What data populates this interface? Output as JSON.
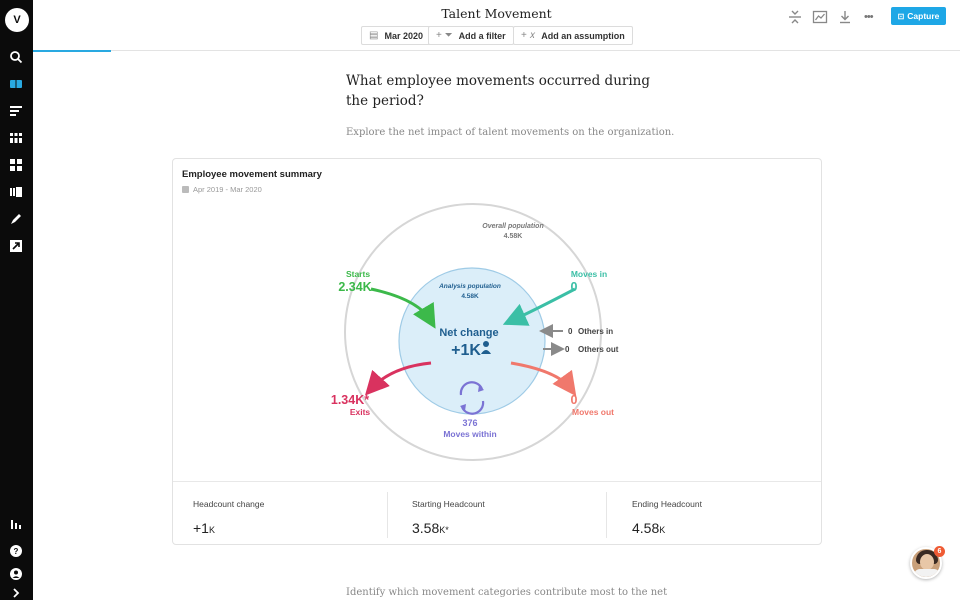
{
  "app": {
    "title": "Talent Movement",
    "logo_text": "V"
  },
  "toolbar": {
    "date_filter": "Mar 2020",
    "add_filter": "Add a filter",
    "add_assumption": "Add an assumption",
    "capture_label": "Capture",
    "more_label": "•••"
  },
  "sidebar": {
    "icons": [
      "search-icon",
      "book-icon",
      "list-icon",
      "grid-dots-icon",
      "dashboard-icon",
      "library-icon",
      "pen-icon",
      "export-icon",
      "bar-chart-icon",
      "help-icon",
      "user-icon",
      "expand-icon"
    ]
  },
  "content": {
    "question": "What employee movements occurred during the period?",
    "subtext": "Explore the net impact of talent movements on the organization.",
    "footer_text": "Identify which movement categories contribute most to the net"
  },
  "card": {
    "title": "Employee movement summary",
    "date_range": "Apr 2019 - Mar 2020"
  },
  "diagram": {
    "overall_label": "Overall population",
    "overall_value": "4.58K",
    "analysis_label": "Analysis population",
    "analysis_value": "4.58K",
    "net_label": "Net change",
    "net_value": "+1K",
    "starts_label": "Starts",
    "starts_value": "2.34K",
    "moves_in_label": "Moves in",
    "moves_in_value": "0",
    "exits_label": "Exits",
    "exits_value": "1.34K*",
    "moves_out_label": "Moves out",
    "moves_out_value": "0",
    "moves_within_label": "Moves within",
    "moves_within_value": "376",
    "others_in_value": "0",
    "others_in_label": "Others in",
    "others_out_value": "0",
    "others_out_label": "Others out",
    "colors": {
      "starts": "#3cb94a",
      "moves_in": "#3bbfa6",
      "exits": "#d9325f",
      "moves_out": "#f0786c",
      "moves_within": "#7b73d4",
      "net": "#1f5e8f",
      "others": "#8a8a8a"
    }
  },
  "stats": [
    {
      "label": "Headcount change",
      "value": "+1",
      "unit": "K"
    },
    {
      "label": "Starting Headcount",
      "value": "3.58",
      "unit": "K*"
    },
    {
      "label": "Ending Headcount",
      "value": "4.58",
      "unit": "K"
    }
  ],
  "chat": {
    "badge_count": "6"
  }
}
